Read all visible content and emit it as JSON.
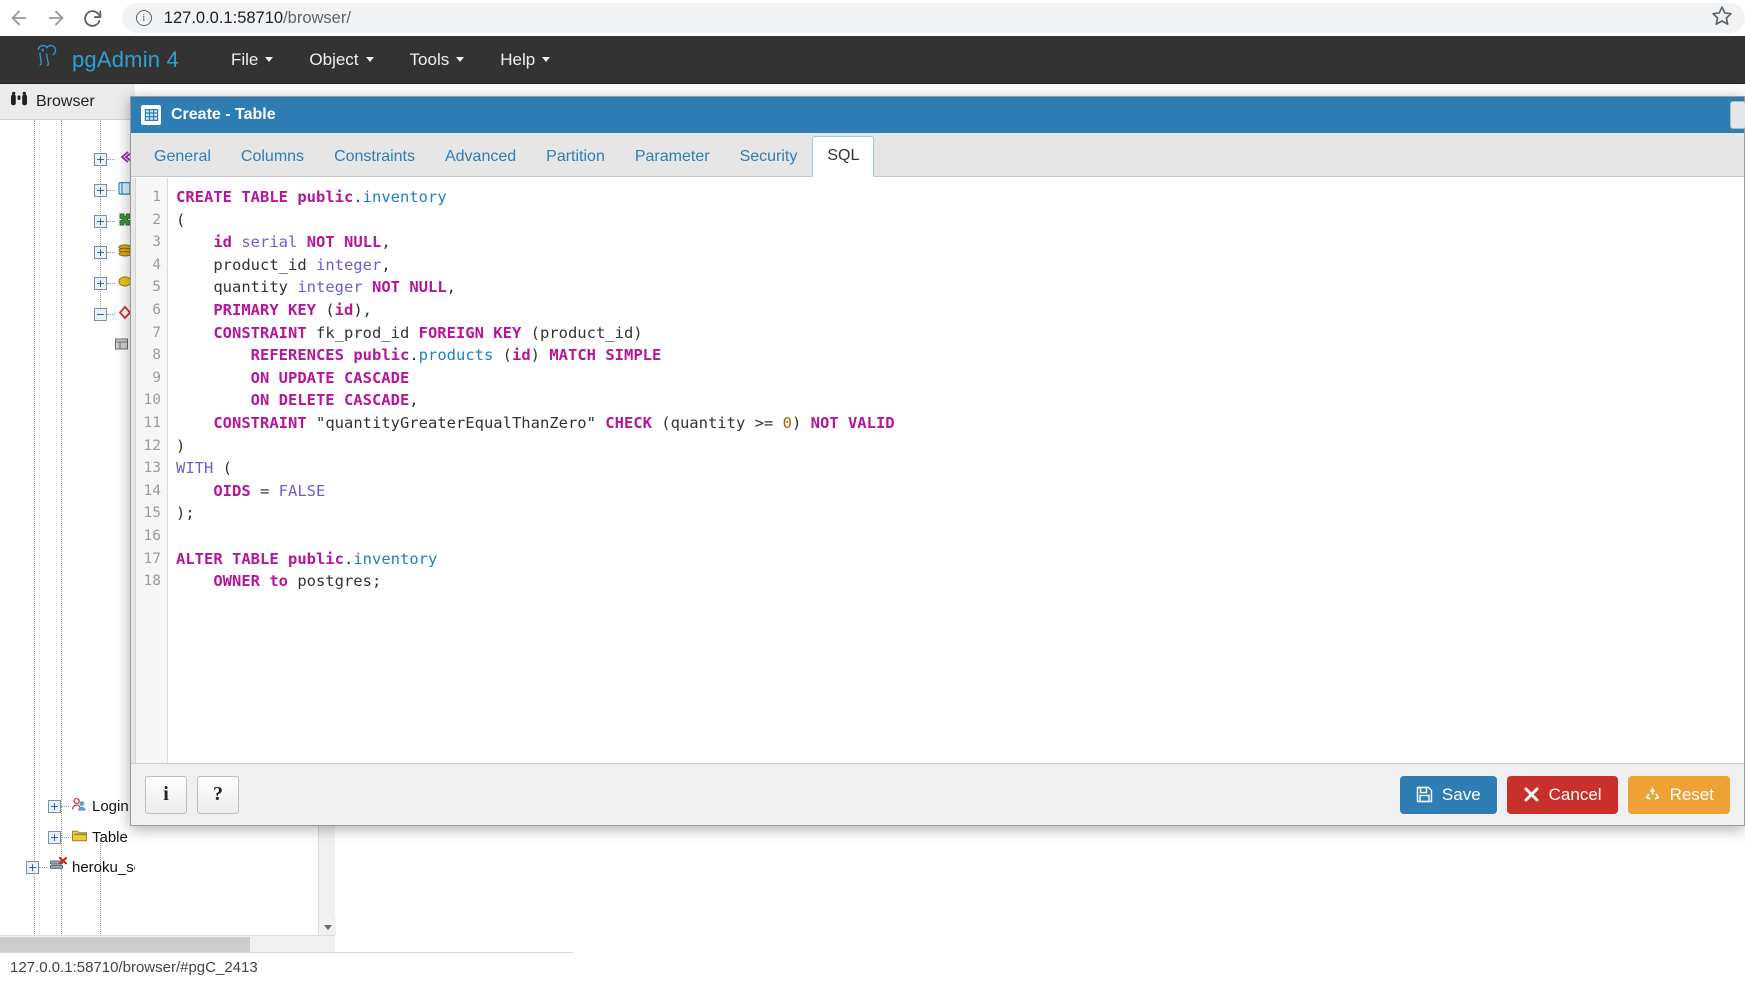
{
  "browser": {
    "back_icon": "arrow-left-icon",
    "forward_icon": "arrow-right-icon",
    "reload_icon": "reload-icon",
    "site_info_icon": "info-circle-icon",
    "url_host": "127.0.0.1:58710",
    "url_path": "/browser/",
    "url_full": "127.0.0.1:58710/browser/",
    "bookmark_icon": "star-icon"
  },
  "app": {
    "brand": "pgAdmin 4",
    "brand_color": "#2e9fd4",
    "menus": [
      {
        "label": "File"
      },
      {
        "label": "Object"
      },
      {
        "label": "Tools"
      },
      {
        "label": "Help"
      }
    ]
  },
  "panel": {
    "header_label": "Browser",
    "header_icon": "binoculars-icon",
    "tree_nodes": [
      {
        "label": "",
        "icon": "magenta-arrow-icon",
        "state": "collapsed"
      },
      {
        "label": "",
        "icon": "catalog-icon",
        "state": "collapsed"
      },
      {
        "label": "",
        "icon": "extension-icon",
        "state": "collapsed"
      },
      {
        "label": "",
        "icon": "ftw-icon",
        "state": "collapsed"
      },
      {
        "label": "",
        "icon": "language-icon",
        "state": "collapsed"
      },
      {
        "label": "",
        "icon": "schema-icon",
        "state": "expanded"
      },
      {
        "label": "",
        "icon": "table-icon",
        "state": "leaf"
      },
      {
        "label": "Login",
        "icon": "login-role-icon",
        "state": "collapsed"
      },
      {
        "label": "Table",
        "icon": "tablespace-icon",
        "state": "collapsed"
      },
      {
        "label": "heroku_server",
        "icon": "server-disconnected-icon",
        "state": "collapsed"
      }
    ]
  },
  "statusbar": {
    "text": "127.0.0.1:58710/browser/#pgC_2413"
  },
  "dialog": {
    "title": "Create - Table",
    "title_icon": "table-icon",
    "title_bg": "#2f7db5",
    "tabs": [
      {
        "label": "General",
        "active": false
      },
      {
        "label": "Columns",
        "active": false
      },
      {
        "label": "Constraints",
        "active": false
      },
      {
        "label": "Advanced",
        "active": false
      },
      {
        "label": "Partition",
        "active": false
      },
      {
        "label": "Parameter",
        "active": false
      },
      {
        "label": "Security",
        "active": false
      },
      {
        "label": "SQL",
        "active": true
      }
    ],
    "sql": {
      "line_numbers": [
        1,
        2,
        3,
        4,
        5,
        6,
        7,
        8,
        9,
        10,
        11,
        12,
        13,
        14,
        15,
        16,
        17,
        18
      ],
      "lines": [
        [
          {
            "t": "CREATE TABLE ",
            "c": "kw"
          },
          {
            "t": "public",
            "c": "kw"
          },
          {
            "t": ".",
            "c": "pln"
          },
          {
            "t": "inventory",
            "c": "ident"
          }
        ],
        [
          {
            "t": "(",
            "c": "pln"
          }
        ],
        [
          {
            "t": "    ",
            "c": "pln"
          },
          {
            "t": "id",
            "c": "kw"
          },
          {
            "t": " ",
            "c": "pln"
          },
          {
            "t": "serial",
            "c": "typ"
          },
          {
            "t": " ",
            "c": "pln"
          },
          {
            "t": "NOT",
            "c": "kw"
          },
          {
            "t": " ",
            "c": "pln"
          },
          {
            "t": "NULL",
            "c": "kw"
          },
          {
            "t": ",",
            "c": "pln"
          }
        ],
        [
          {
            "t": "    product_id ",
            "c": "pln"
          },
          {
            "t": "integer",
            "c": "typ"
          },
          {
            "t": ",",
            "c": "pln"
          }
        ],
        [
          {
            "t": "    quantity ",
            "c": "pln"
          },
          {
            "t": "integer",
            "c": "typ"
          },
          {
            "t": " ",
            "c": "pln"
          },
          {
            "t": "NOT",
            "c": "kw"
          },
          {
            "t": " ",
            "c": "pln"
          },
          {
            "t": "NULL",
            "c": "kw"
          },
          {
            "t": ",",
            "c": "pln"
          }
        ],
        [
          {
            "t": "    ",
            "c": "pln"
          },
          {
            "t": "PRIMARY KEY",
            "c": "kw"
          },
          {
            "t": " (",
            "c": "pln"
          },
          {
            "t": "id",
            "c": "kw"
          },
          {
            "t": "),",
            "c": "pln"
          }
        ],
        [
          {
            "t": "    ",
            "c": "pln"
          },
          {
            "t": "CONSTRAINT",
            "c": "kw"
          },
          {
            "t": " fk_prod_id ",
            "c": "pln"
          },
          {
            "t": "FOREIGN KEY",
            "c": "kw"
          },
          {
            "t": " (product_id)",
            "c": "pln"
          }
        ],
        [
          {
            "t": "        ",
            "c": "pln"
          },
          {
            "t": "REFERENCES",
            "c": "kw"
          },
          {
            "t": " ",
            "c": "pln"
          },
          {
            "t": "public",
            "c": "kw"
          },
          {
            "t": ".",
            "c": "pln"
          },
          {
            "t": "products",
            "c": "ident"
          },
          {
            "t": " (",
            "c": "pln"
          },
          {
            "t": "id",
            "c": "kw"
          },
          {
            "t": ") ",
            "c": "pln"
          },
          {
            "t": "MATCH SIMPLE",
            "c": "kw"
          }
        ],
        [
          {
            "t": "        ",
            "c": "pln"
          },
          {
            "t": "ON UPDATE CASCADE",
            "c": "kw"
          }
        ],
        [
          {
            "t": "        ",
            "c": "pln"
          },
          {
            "t": "ON DELETE CASCADE",
            "c": "kw"
          },
          {
            "t": ",",
            "c": "pln"
          }
        ],
        [
          {
            "t": "    ",
            "c": "pln"
          },
          {
            "t": "CONSTRAINT",
            "c": "kw"
          },
          {
            "t": " \"quantityGreaterEqualThanZero\" ",
            "c": "str"
          },
          {
            "t": "CHECK",
            "c": "kw"
          },
          {
            "t": " (quantity >= ",
            "c": "pln"
          },
          {
            "t": "0",
            "c": "num"
          },
          {
            "t": ") ",
            "c": "pln"
          },
          {
            "t": "NOT VALID",
            "c": "kw"
          }
        ],
        [
          {
            "t": ")",
            "c": "pln"
          }
        ],
        [
          {
            "t": "WITH",
            "c": "typ"
          },
          {
            "t": " (",
            "c": "pln"
          }
        ],
        [
          {
            "t": "    ",
            "c": "pln"
          },
          {
            "t": "OIDS",
            "c": "kw"
          },
          {
            "t": " = ",
            "c": "pln"
          },
          {
            "t": "FALSE",
            "c": "typ"
          }
        ],
        [
          {
            "t": ");",
            "c": "pln"
          }
        ],
        [
          {
            "t": "",
            "c": "pln"
          }
        ],
        [
          {
            "t": "ALTER TABLE ",
            "c": "kw"
          },
          {
            "t": "public",
            "c": "kw"
          },
          {
            "t": ".",
            "c": "pln"
          },
          {
            "t": "inventory",
            "c": "ident"
          }
        ],
        [
          {
            "t": "    ",
            "c": "pln"
          },
          {
            "t": "OWNER to",
            "c": "kw"
          },
          {
            "t": " postgres;",
            "c": "pln"
          }
        ]
      ],
      "plain_text": "CREATE TABLE public.inventory\n(\n    id serial NOT NULL,\n    product_id integer,\n    quantity integer NOT NULL,\n    PRIMARY KEY (id),\n    CONSTRAINT fk_prod_id FOREIGN KEY (product_id)\n        REFERENCES public.products (id) MATCH SIMPLE\n        ON UPDATE CASCADE\n        ON DELETE CASCADE,\n    CONSTRAINT \"quantityGreaterEqualThanZero\" CHECK (quantity >= 0) NOT VALID\n)\nWITH (\n    OIDS = FALSE\n);\n\nALTER TABLE public.inventory\n    OWNER to postgres;"
    },
    "footer": {
      "info_label": "i",
      "info_icon": "info-icon",
      "help_label": "?",
      "help_icon": "question-mark-icon",
      "save_label": "Save",
      "save_icon": "floppy-disk-icon",
      "save_color": "#2f7db5",
      "cancel_label": "Cancel",
      "cancel_icon": "x-mark-icon",
      "cancel_color": "#c9302c",
      "reset_label": "Reset",
      "reset_icon": "recycle-icon",
      "reset_color": "#eea236"
    }
  }
}
